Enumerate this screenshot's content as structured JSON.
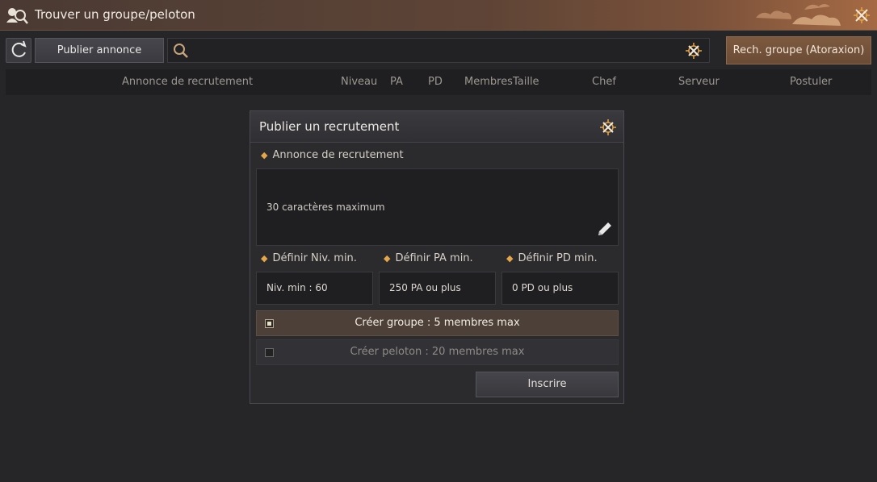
{
  "window": {
    "title": "Trouver un groupe/peloton"
  },
  "toolbar": {
    "publish_label": "Publier annonce",
    "search_value": "",
    "search_group_label": "Rech. groupe (Atoraxion)"
  },
  "columns": [
    "Annonce de recrutement",
    "Niveau",
    "PA",
    "PD",
    "MembresTaille",
    "Chef",
    "Serveur",
    "Postuler"
  ],
  "dialog": {
    "title": "Publier un recrutement",
    "announce_label": "Annonce de recrutement",
    "announce_placeholder": "30 caractères maximum",
    "min_level_label": "Définir Niv. min.",
    "min_ap_label": "Définir PA min.",
    "min_dp_label": "Définir PD min.",
    "min_level_value": "Niv. min : 60",
    "min_ap_value": "250 PA ou plus",
    "min_dp_value": "0 PD ou plus",
    "option_group": "Créer groupe : 5 membres max",
    "option_platoon": "Créer peloton : 20 membres max",
    "submit_label": "Inscrire"
  },
  "colors": {
    "accent": "#e5a64a",
    "selected_row": "#4d4038",
    "search_group_button": "#7d5a3f"
  },
  "icons": [
    "group-search-icon",
    "refresh-icon",
    "search-icon",
    "clear-icon",
    "close-icon",
    "pencil-icon"
  ]
}
